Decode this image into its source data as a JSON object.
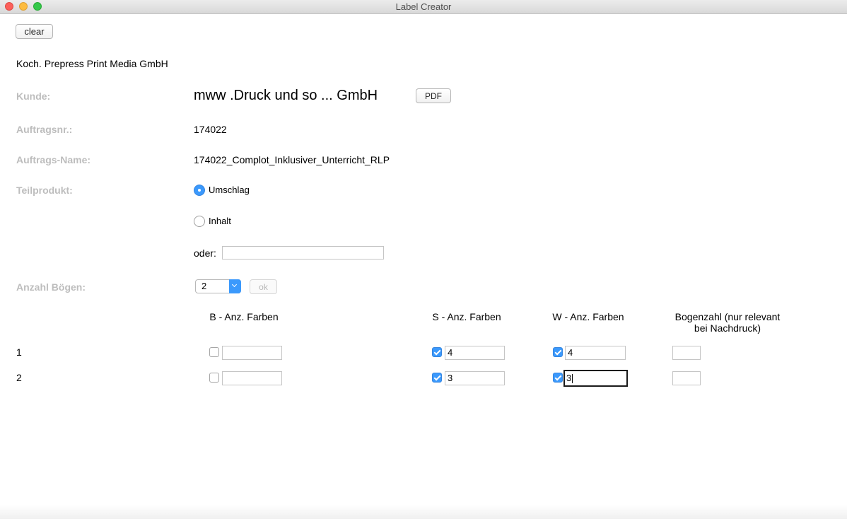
{
  "window": {
    "title": "Label Creator"
  },
  "toolbar": {
    "clear_label": "clear"
  },
  "company": "Koch. Prepress Print Media GmbH",
  "form": {
    "kunde_label": "Kunde:",
    "kunde_value": "mww .Druck und so ... GmbH",
    "pdf_label": "PDF",
    "auftragsnr_label": "Auftragsnr.:",
    "auftragsnr_value": "174022",
    "auftragsname_label": "Auftrags-Name:",
    "auftragsname_value": "174022_Complot_Inklusiver_Unterricht_RLP",
    "teilprodukt_label": "Teilprodukt:",
    "radio_umschlag": "Umschlag",
    "radio_inhalt": "Inhalt",
    "selected_teilprodukt": "Umschlag",
    "oder_label": "oder:",
    "oder_value": "",
    "anzahl_label": "Anzahl Bögen:",
    "anzahl_value": "2",
    "ok_label": "ok"
  },
  "table": {
    "headers": {
      "b": "B - Anz. Farben",
      "s": "S - Anz. Farben",
      "w": "W - Anz. Farben",
      "bogen_line1": "Bogenzahl (nur relevant",
      "bogen_line2": "bei Nachdruck)"
    },
    "rows": [
      {
        "index": "1",
        "b_checked": false,
        "b_value": "",
        "s_checked": true,
        "s_value": "4",
        "w_checked": true,
        "w_value": "4",
        "bogen_value": ""
      },
      {
        "index": "2",
        "b_checked": false,
        "b_value": "",
        "s_checked": true,
        "s_value": "3",
        "w_checked": true,
        "w_value": "3",
        "bogen_value": ""
      }
    ]
  },
  "colors": {
    "accent": "#3b99fc",
    "label_gray": "#bdbdbd"
  }
}
